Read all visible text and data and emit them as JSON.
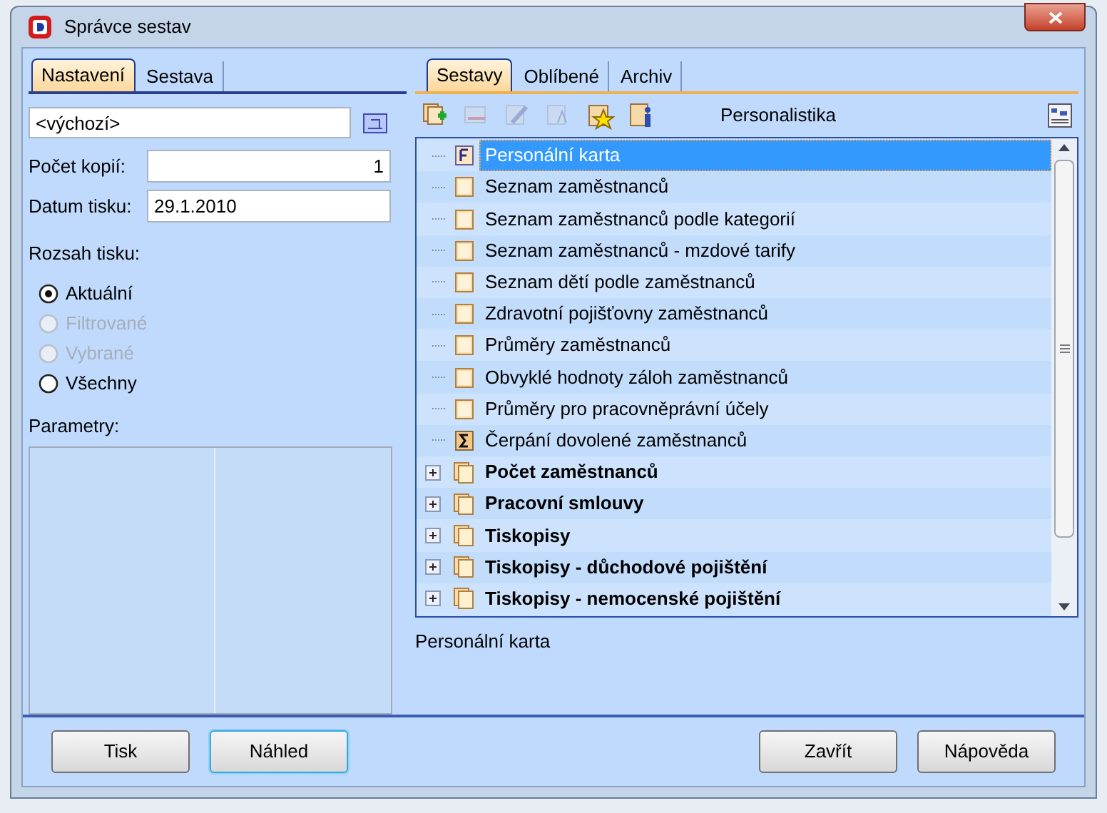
{
  "window": {
    "title": "Správce sestav"
  },
  "left_tabs": [
    {
      "label": "Nastavení",
      "selected": true
    },
    {
      "label": "Sestava",
      "selected": false
    }
  ],
  "template_field": {
    "value": "<výchozí>"
  },
  "copies": {
    "label": "Počet kopií:",
    "value": "1"
  },
  "print_date": {
    "label": "Datum tisku:",
    "value": "29.1.2010"
  },
  "range": {
    "label": "Rozsah tisku:",
    "options": [
      {
        "label": "Aktuální",
        "selected": true,
        "disabled": false
      },
      {
        "label": "Filtrované",
        "selected": false,
        "disabled": true
      },
      {
        "label": "Vybrané",
        "selected": false,
        "disabled": true
      },
      {
        "label": "Všechny",
        "selected": false,
        "disabled": false
      }
    ]
  },
  "parameters": {
    "label": "Parametry:"
  },
  "right_tabs": [
    {
      "label": "Sestavy",
      "selected": true
    },
    {
      "label": "Oblíbené",
      "selected": false
    },
    {
      "label": "Archiv",
      "selected": false
    }
  ],
  "toolbar": {
    "buttons": [
      {
        "kind": "add",
        "disabled": false
      },
      {
        "kind": "delete",
        "disabled": true
      },
      {
        "kind": "edit",
        "disabled": true
      },
      {
        "kind": "properties",
        "disabled": true
      },
      {
        "kind": "favorite",
        "disabled": false
      },
      {
        "kind": "info",
        "disabled": false
      }
    ],
    "category": "Personalistika"
  },
  "tree": [
    {
      "label": "Personální karta",
      "kind": "form",
      "selected": true
    },
    {
      "label": "Seznam zaměstnanců",
      "kind": "report",
      "selected": false
    },
    {
      "label": "Seznam zaměstnanců podle kategorií",
      "kind": "report",
      "selected": false
    },
    {
      "label": "Seznam zaměstnanců - mzdové tarify",
      "kind": "report",
      "selected": false
    },
    {
      "label": "Seznam dětí podle zaměstnanců",
      "kind": "report",
      "selected": false
    },
    {
      "label": "Zdravotní pojišťovny zaměstnanců",
      "kind": "report",
      "selected": false
    },
    {
      "label": "Průměry zaměstnanců",
      "kind": "report",
      "selected": false
    },
    {
      "label": "Obvyklé hodnoty záloh zaměstnanců",
      "kind": "report",
      "selected": false
    },
    {
      "label": "Průměry pro pracovněprávní účely",
      "kind": "report",
      "selected": false
    },
    {
      "label": "Čerpání dovolené zaměstnanců",
      "kind": "sum",
      "selected": false
    },
    {
      "label": "Počet zaměstnanců",
      "kind": "folder",
      "expanded": false,
      "selected": false
    },
    {
      "label": "Pracovní smlouvy",
      "kind": "folder",
      "expanded": false,
      "selected": false
    },
    {
      "label": "Tiskopisy",
      "kind": "folder",
      "expanded": false,
      "selected": false
    },
    {
      "label": "Tiskopisy - důchodové pojištění",
      "kind": "folder",
      "expanded": false,
      "selected": false
    },
    {
      "label": "Tiskopisy - nemocenské pojištění",
      "kind": "folder",
      "expanded": false,
      "selected": false
    }
  ],
  "description": "Personální karta",
  "buttons": [
    {
      "label": "Tisk",
      "focused": false
    },
    {
      "label": "Náhled",
      "focused": true
    },
    {
      "label": "Zavřít",
      "focused": false
    },
    {
      "label": "Nápověda",
      "focused": false
    }
  ]
}
